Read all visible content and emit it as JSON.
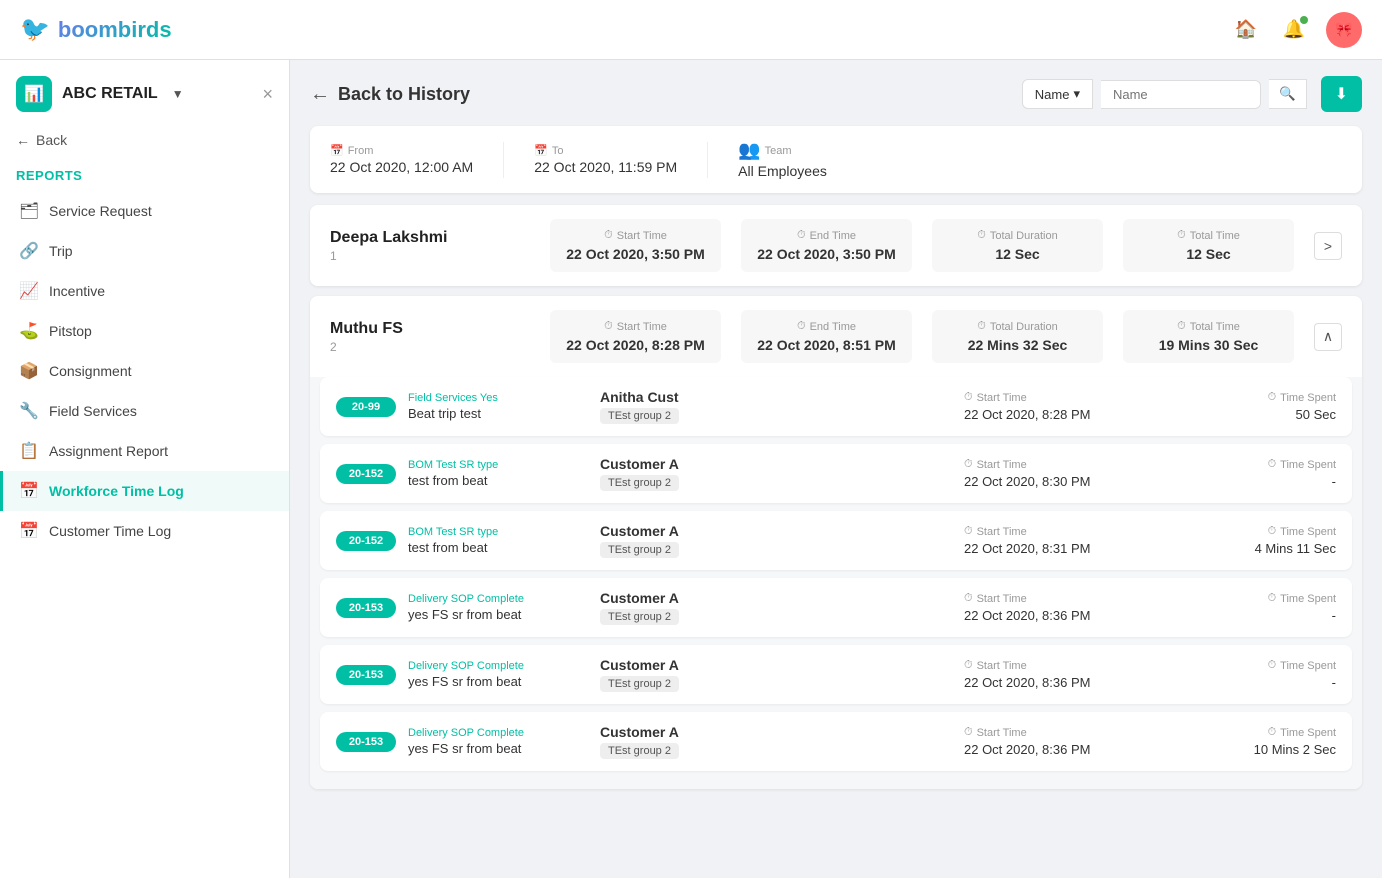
{
  "app": {
    "name": "boombirds",
    "logo_icon": "🐦"
  },
  "nav": {
    "home_icon": "🏠",
    "bell_icon": "🔔",
    "avatar_text": "🎀"
  },
  "sidebar": {
    "close_label": "×",
    "org_name": "ABC RETAIL",
    "org_icon": "📊",
    "back_label": "Back",
    "section_label": "Reports",
    "items": [
      {
        "id": "service-request",
        "label": "Service Request",
        "icon": "🗂"
      },
      {
        "id": "trip",
        "label": "Trip",
        "icon": "🔗"
      },
      {
        "id": "incentive",
        "label": "Incentive",
        "icon": "📈"
      },
      {
        "id": "pitstop",
        "label": "Pitstop",
        "icon": "⛳"
      },
      {
        "id": "consignment",
        "label": "Consignment",
        "icon": "📦"
      },
      {
        "id": "field-services",
        "label": "Field Services",
        "icon": "🔧"
      },
      {
        "id": "assignment-report",
        "label": "Assignment Report",
        "icon": "📋"
      },
      {
        "id": "workforce-time-log",
        "label": "Workforce Time Log",
        "icon": "📅",
        "active": true
      },
      {
        "id": "customer-time-log",
        "label": "Customer Time Log",
        "icon": "📅"
      }
    ]
  },
  "page": {
    "back_label": "Back to History",
    "search_dropdown": "Name",
    "search_placeholder": "Name",
    "search_icon": "🔍",
    "download_icon": "⬇"
  },
  "filters": {
    "from_label": "From",
    "from_value": "22 Oct 2020, 12:00 AM",
    "to_label": "To",
    "to_value": "22 Oct 2020, 11:59 PM",
    "team_label": "Team",
    "team_value": "All Employees",
    "team_icon": "👥"
  },
  "columns": {
    "start_time": "Start Time",
    "end_time": "End Time",
    "total_duration": "Total Duration",
    "total_time": "Total Time",
    "time_spent": "Time Spent",
    "time_spent_unit": "Mins II Sec"
  },
  "employees": [
    {
      "name": "Deepa Lakshmi",
      "number": "1",
      "start_time": "22 Oct 2020, 3:50 PM",
      "end_time": "22 Oct 2020, 3:50 PM",
      "total_duration": "12 Sec",
      "total_time": "12 Sec",
      "expanded": false,
      "assignments": []
    },
    {
      "name": "Muthu FS",
      "number": "2",
      "start_time": "22 Oct 2020, 8:28 PM",
      "end_time": "22 Oct 2020, 8:51 PM",
      "total_duration": "22 Mins 32 Sec",
      "total_time": "19 Mins 30 Sec",
      "expanded": true,
      "assignments": [
        {
          "badge": "20-99",
          "type": "Field Services Yes",
          "name": "Beat trip test",
          "customer": "Anitha Cust",
          "group": "TEst group 2",
          "start_time": "22 Oct 2020, 8:28 PM",
          "time_spent": "50 Sec"
        },
        {
          "badge": "20-152",
          "type": "BOM Test SR type",
          "name": "test from beat",
          "customer": "Customer A",
          "group": "TEst group 2",
          "start_time": "22 Oct 2020, 8:30 PM",
          "time_spent": "-"
        },
        {
          "badge": "20-152",
          "type": "BOM Test SR type",
          "name": "test from beat",
          "customer": "Customer A",
          "group": "TEst group 2",
          "start_time": "22 Oct 2020, 8:31 PM",
          "time_spent": "4 Mins 11 Sec"
        },
        {
          "badge": "20-153",
          "type": "Delivery SOP Complete",
          "name": "yes FS sr from beat",
          "customer": "Customer A",
          "group": "TEst group 2",
          "start_time": "22 Oct 2020, 8:36 PM",
          "time_spent": "-"
        },
        {
          "badge": "20-153",
          "type": "Delivery SOP Complete",
          "name": "yes FS sr from beat",
          "customer": "Customer A",
          "group": "TEst group 2",
          "start_time": "22 Oct 2020, 8:36 PM",
          "time_spent": "-"
        },
        {
          "badge": "20-153",
          "type": "Delivery SOP Complete",
          "name": "yes FS sr from beat",
          "customer": "Customer A",
          "group": "TEst group 2",
          "start_time": "22 Oct 2020, 8:36 PM",
          "time_spent": "10 Mins 2 Sec"
        }
      ]
    }
  ]
}
